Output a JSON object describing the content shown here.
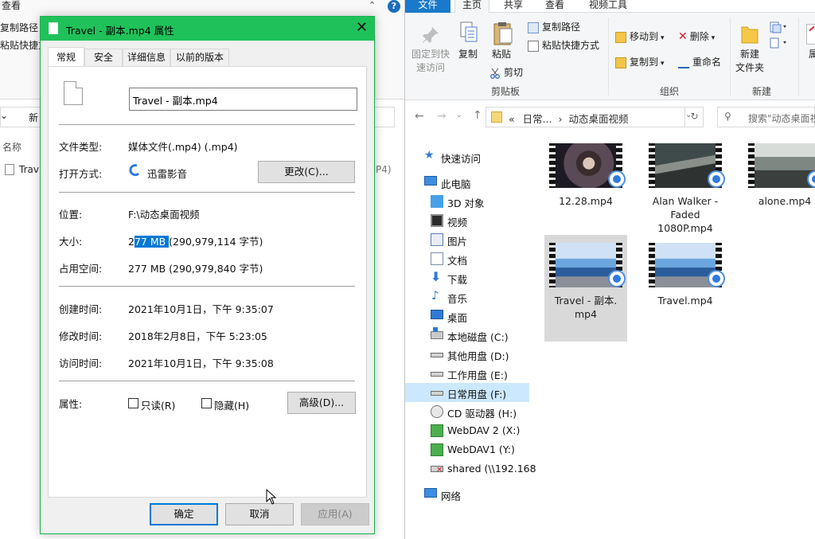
{
  "bg_window": {
    "tab_view": "查看",
    "copy_path": "复制路径",
    "paste_shortcut": "粘贴快捷方",
    "address_fragment": "新",
    "column_name": "名称",
    "file_fragment": "Trav",
    "size_fragment": "P4)"
  },
  "explorer": {
    "tabs": {
      "file": "文件",
      "home": "主页",
      "share": "共享",
      "view": "查看",
      "video_tools": "视频工具"
    },
    "ribbon": {
      "pin_quick_access": "固定到快\n速访问",
      "copy": "复制",
      "paste": "粘贴",
      "copy_path": "复制路径",
      "paste_shortcut": "粘贴快捷方式",
      "cut": "剪切",
      "clipboard_group": "剪贴板",
      "move_to": "移动到",
      "delete": "删除",
      "copy_to": "复制到",
      "rename": "重命名",
      "organize_group": "组织",
      "new_folder": "新建\n文件夹",
      "new_group": "新建",
      "properties_fragment": "属"
    },
    "breadcrumb": {
      "prefix": "«",
      "part1": "日常...",
      "separator": "›",
      "part2": "动态桌面视频"
    },
    "search_placeholder": "搜索\"动态桌面视",
    "nav": [
      {
        "label": "快速访问"
      },
      {
        "label": "此电脑"
      },
      {
        "label": "3D 对象"
      },
      {
        "label": "视频"
      },
      {
        "label": "图片"
      },
      {
        "label": "文档"
      },
      {
        "label": "下载"
      },
      {
        "label": "音乐"
      },
      {
        "label": "桌面"
      },
      {
        "label": "本地磁盘 (C:)"
      },
      {
        "label": "其他用盘 (D:)"
      },
      {
        "label": "工作用盘 (E:)"
      },
      {
        "label": "日常用盘 (F:)"
      },
      {
        "label": "CD 驱动器 (H:)"
      },
      {
        "label": "WebDAV 2 (X:)"
      },
      {
        "label": "WebDAV1 (Y:)"
      },
      {
        "label": "shared (\\\\192.168"
      },
      {
        "label": "网络"
      }
    ],
    "files": [
      {
        "name": "12.28.mp4"
      },
      {
        "name": "Alan Walker -\nFaded\n1080P.mp4"
      },
      {
        "name": "alone.mp4"
      },
      {
        "name": "Travel - 副本.\nmp4"
      },
      {
        "name": "Travel.mp4"
      }
    ]
  },
  "dialog": {
    "title": "Travel - 副本.mp4 属性",
    "tabs": [
      "常规",
      "安全",
      "详细信息",
      "以前的版本"
    ],
    "filename": "Travel - 副本.mp4",
    "file_type_label": "文件类型:",
    "file_type_value": "媒体文件(.mp4) (.mp4)",
    "opens_with_label": "打开方式:",
    "opens_with_value": "迅雷影音",
    "change_button": "更改(C)...",
    "location_label": "位置:",
    "location_value": "F:\\动态桌面视频",
    "size_label": "大小:",
    "size_value_pre": "2",
    "size_value_sel": "77 MB ",
    "size_value_post": "(290,979,114 字节)",
    "size_on_disk_label": "占用空间:",
    "size_on_disk_value": "277 MB (290,979,840 字节)",
    "created_label": "创建时间:",
    "created_value": "2021年10月1日，下午 9:35:07",
    "modified_label": "修改时间:",
    "modified_value": "2018年2月8日，下午 5:23:05",
    "accessed_label": "访问时间:",
    "accessed_value": "2021年10月1日，下午 9:35:08",
    "attributes_label": "属性:",
    "readonly_label": "只读(R)",
    "hidden_label": "隐藏(H)",
    "advanced_button": "高级(D)...",
    "ok_button": "确定",
    "cancel_button": "取消",
    "apply_button": "应用(A)"
  }
}
